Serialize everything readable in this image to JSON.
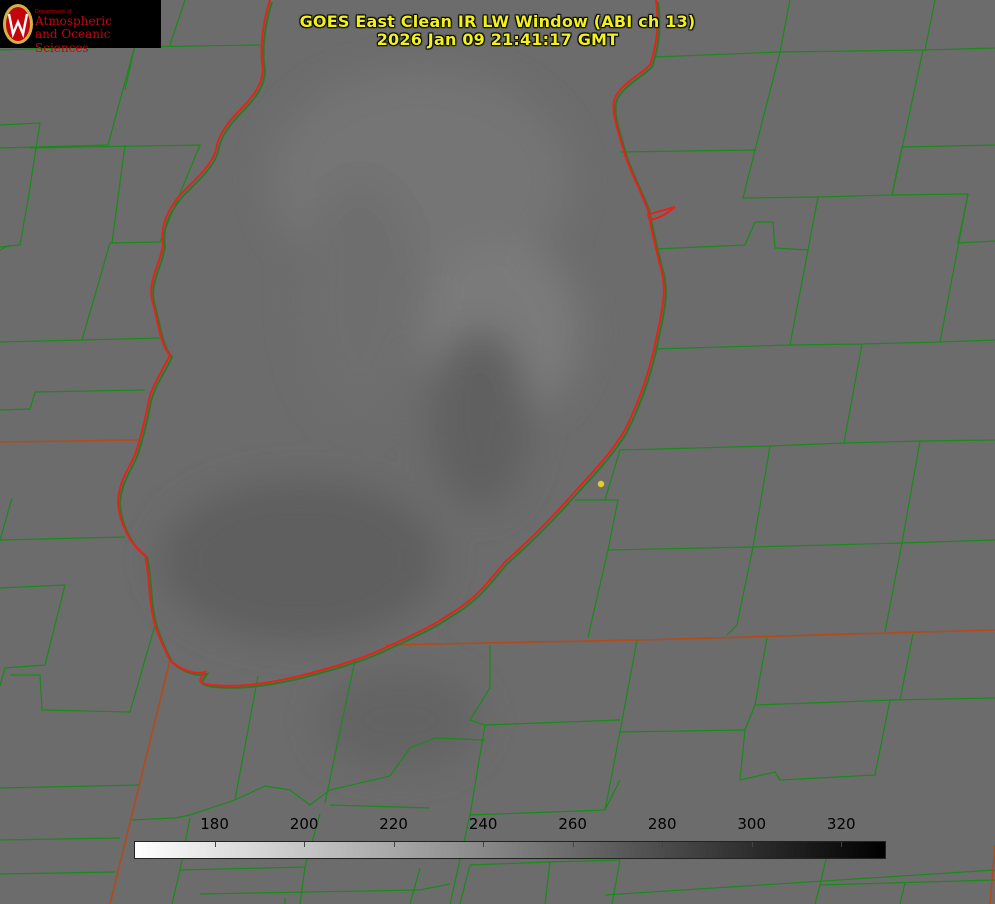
{
  "header": {
    "title_line1": "GOES East Clean IR LW Window (ABI ch 13)",
    "title_line2": "2026 Jan 09 21:41:17 GMT"
  },
  "logo": {
    "department": "Department of",
    "line1": "Atmospheric",
    "line2": "and Oceanic Sciences"
  },
  "colorbar": {
    "min": 162,
    "max": 330,
    "ticks": [
      "180",
      "200",
      "220",
      "240",
      "260",
      "280",
      "300",
      "320"
    ],
    "color_low": "#ffffff",
    "color_high": "#000000"
  },
  "colors": {
    "county_lines": "#1a8a1a",
    "state_lines": "#b24a1a",
    "coastline": "#e8201a",
    "title_text": "#f2f21a",
    "marker": "#e0d020"
  }
}
